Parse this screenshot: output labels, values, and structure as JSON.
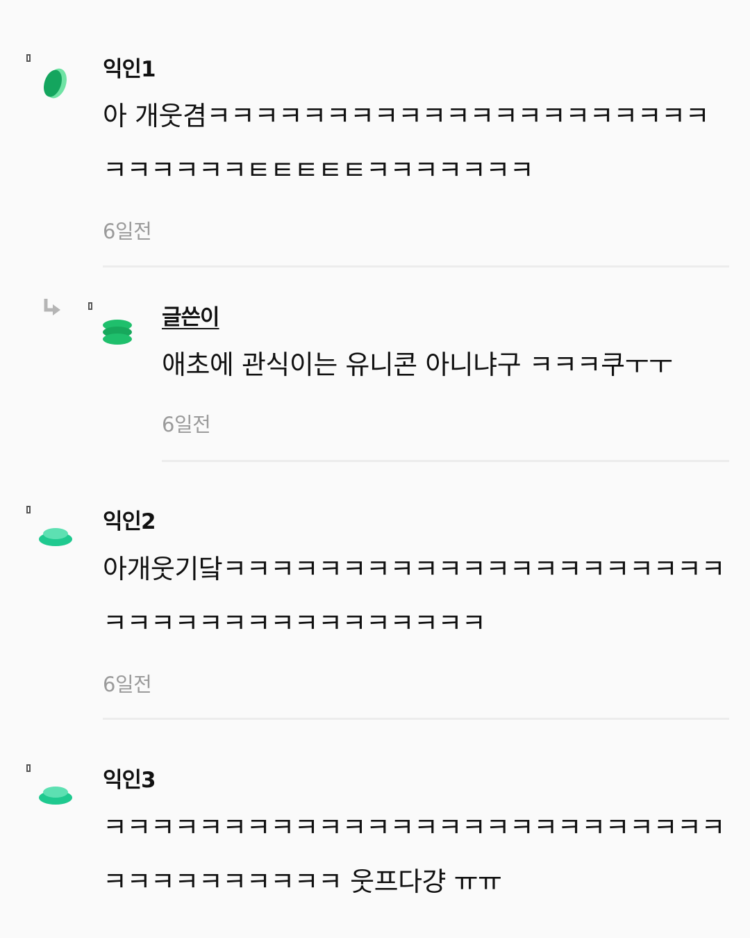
{
  "comments": [
    {
      "author": "익인1",
      "text": "아 개웃겸ㅋㅋㅋㅋㅋㅋㅋㅋㅋㅋㅋㅋㅋㅋㅋㅋㅋㅋㅋㅋㅋㅋㅋㅋㅋㅋㅋㅌㅌㅌㅌㅌㅋㅋㅋㅋㅋㅋㅋ",
      "time": "6일전",
      "avatar_color": "#14b36a"
    },
    {
      "author": "글쓴이",
      "text": "애초에 관식이는 유니콘 아니냐구 ㅋㅋㅋ쿠ㅜㅜ",
      "time": "6일전",
      "avatar_color": "#1fbf6c",
      "is_reply": true
    },
    {
      "author": "익인2",
      "text": "아개웃기닼ㅋㅋㅋㅋㅋㅋㅋㅋㅋㅋㅋㅋㅋㅋㅋㅋㅋㅋㅋㅋㅋㅋㅋㅋㅋㅋㅋㅋㅋㅋㅋㅋㅋㅋㅋㅋㅋ",
      "time": "6일전",
      "avatar_color": "#1fc98f"
    },
    {
      "author": "익인3",
      "text": "ㅋㅋㅋㅋㅋㅋㅋㅋㅋㅋㅋㅋㅋㅋㅋㅋㅋㅋㅋㅋㅋㅋㅋㅋㅋㅋㅋㅋㅋㅋㅋㅋㅋㅋㅋㅋ 웃프다걍 ㅠㅠ",
      "time": "",
      "avatar_color": "#1fc98f"
    }
  ]
}
